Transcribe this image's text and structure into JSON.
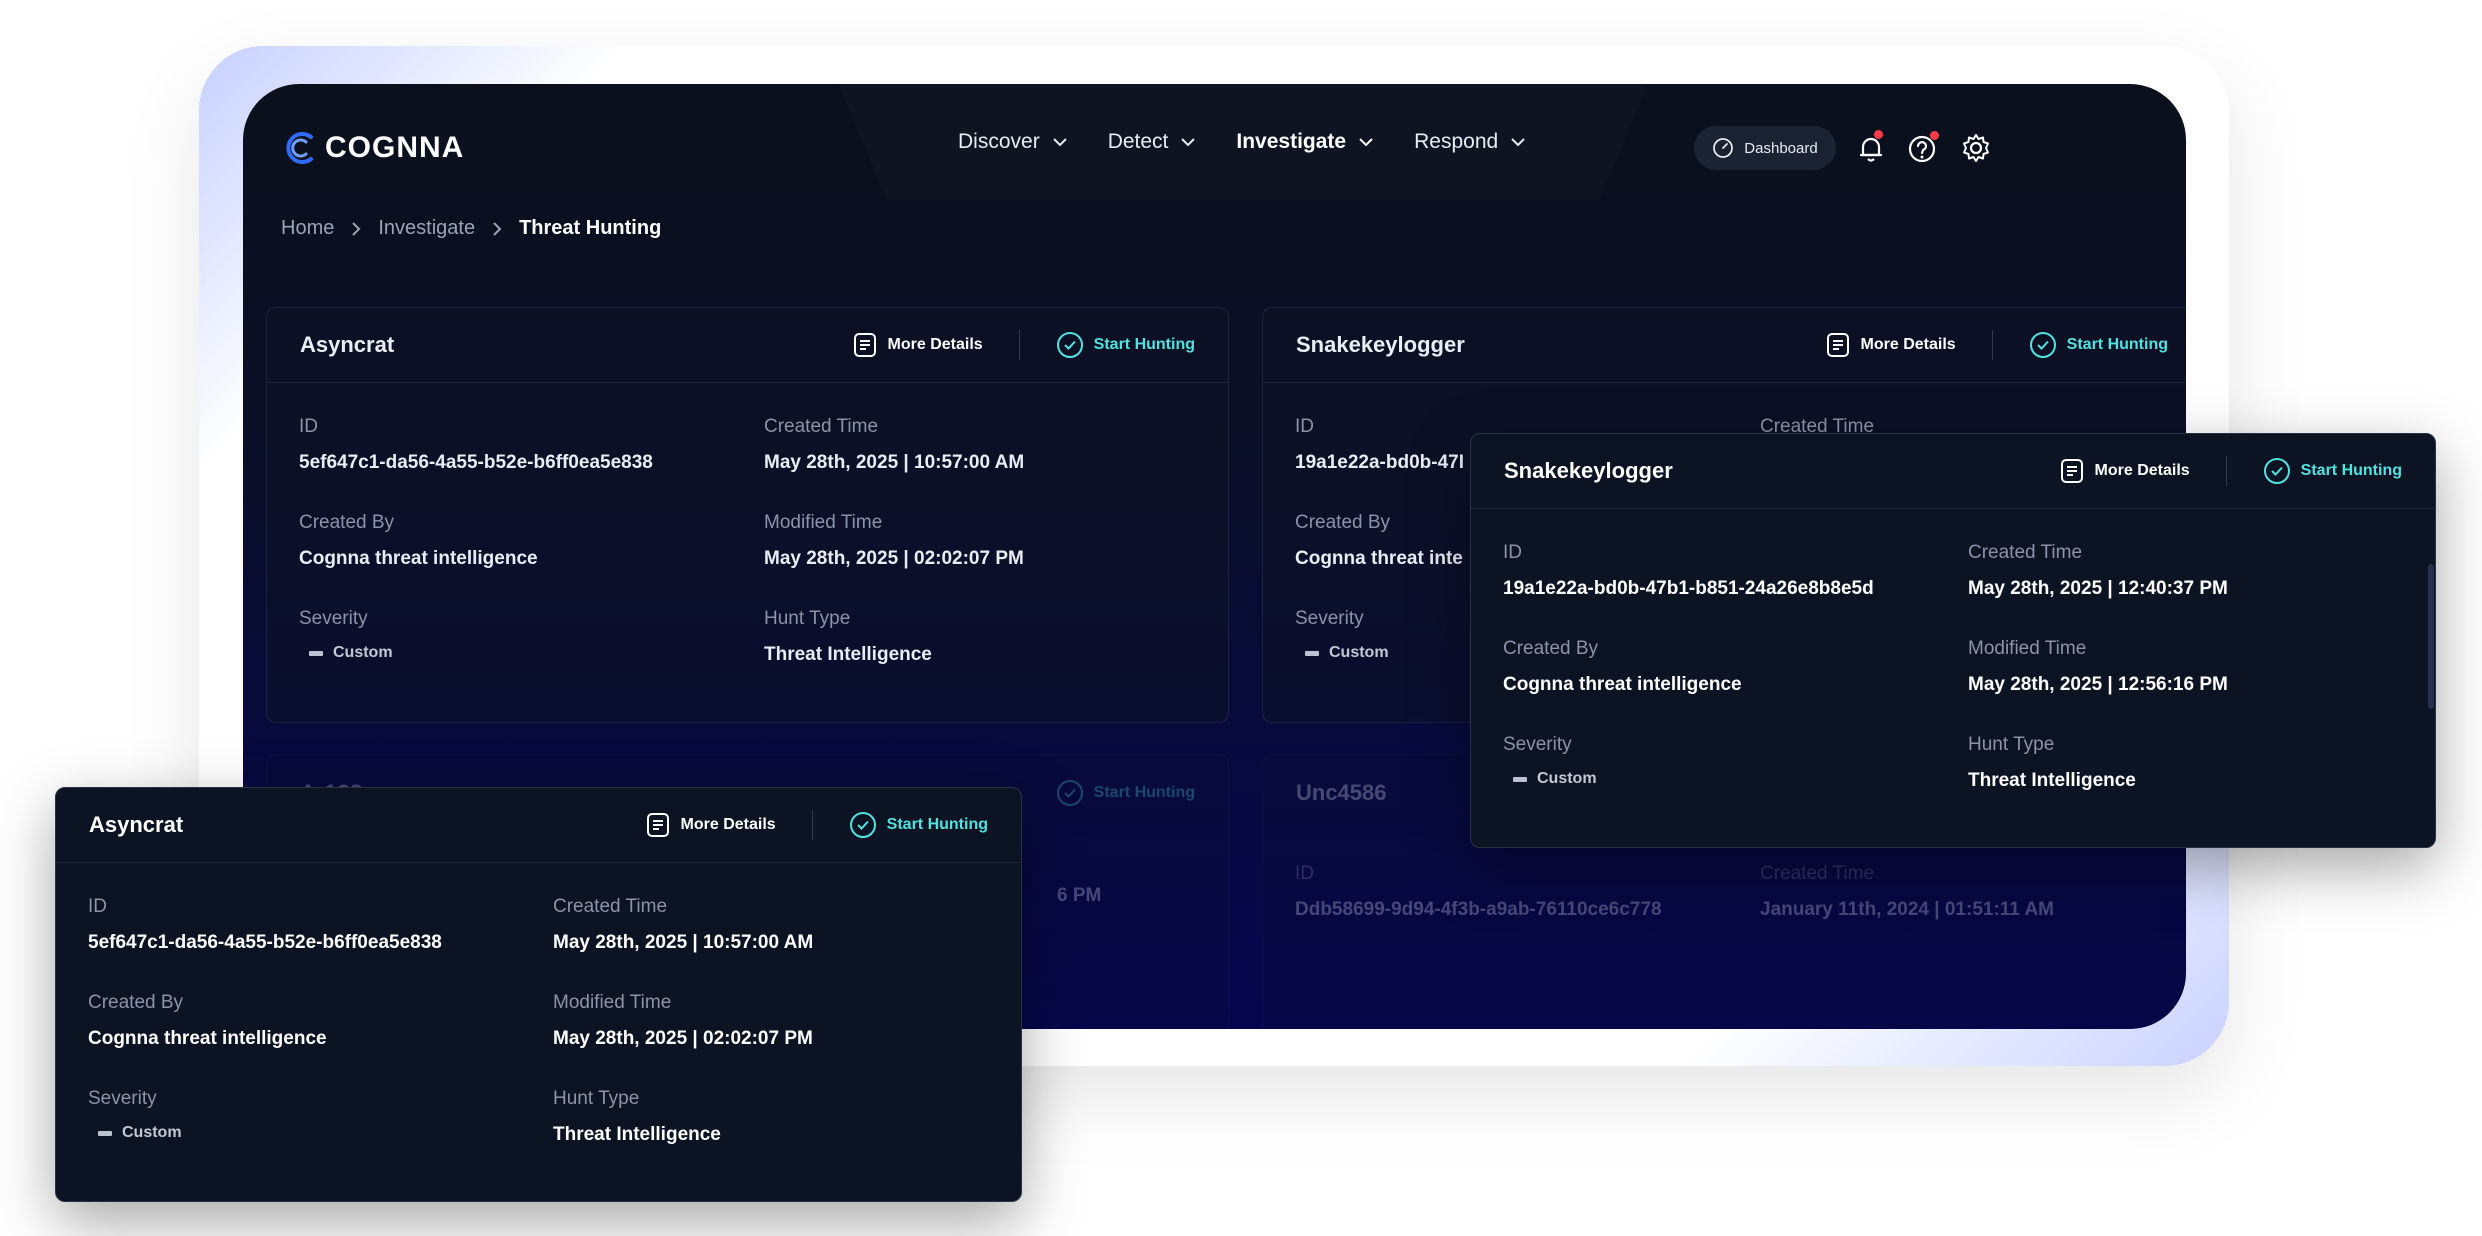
{
  "brand": {
    "name": "COGNNA"
  },
  "nav": {
    "items": [
      {
        "label": "Discover",
        "active": false
      },
      {
        "label": "Detect",
        "active": false
      },
      {
        "label": "Investigate",
        "active": true
      },
      {
        "label": "Respond",
        "active": false
      }
    ],
    "dashboard_label": "Dashboard",
    "icons": [
      "dashboard-gauge-icon",
      "bell-icon",
      "help-icon",
      "gear-icon"
    ]
  },
  "breadcrumb": [
    "Home",
    "Investigate",
    "Threat Hunting"
  ],
  "actions": {
    "more_details": "More Details",
    "start_hunting": "Start Hunting"
  },
  "labels": {
    "id": "ID",
    "created_time": "Created Time",
    "created_by": "Created By",
    "modified_time": "Modified Time",
    "severity": "Severity",
    "hunt_type": "Hunt Type"
  },
  "cards": {
    "asyncrat": {
      "title": "Asyncrat",
      "id": "5ef647c1-da56-4a55-b52e-b6ff0ea5e838",
      "created_time": "May 28th, 2025 | 10:57:00 AM",
      "created_by": "Cognna threat intelligence",
      "modified_time": "May 28th, 2025 | 02:02:07 PM",
      "severity": "Custom",
      "hunt_type": "Threat Intelligence"
    },
    "snakekeylogger": {
      "title": "Snakekeylogger",
      "id": "19a1e22a-bd0b-47b1-b851-24a26e8b8e5d",
      "id_truncated": "19a1e22a-bd0b-47I",
      "created_by_truncated": "Cognna threat inte",
      "created_time": "May 28th, 2025 | 12:40:37 PM",
      "created_by": "Cognna threat intelligence",
      "modified_time": "May 28th, 2025 | 12:56:16 PM",
      "severity": "Custom",
      "hunt_type": "Threat Intelligence"
    },
    "unc4586": {
      "title": "Unc4586",
      "id": "Ddb58699-9d94-4f3b-a9ab-76110ce6c778",
      "created_time": "January 11th, 2024 | 01:51:11 AM",
      "obscured_title": "Ar1?8",
      "obscured_time": "6 PM"
    }
  },
  "colors": {
    "accent_teal": "#4fe3e0",
    "alert_red": "#ff3b4a",
    "logo_blue": "#2f6bff"
  }
}
